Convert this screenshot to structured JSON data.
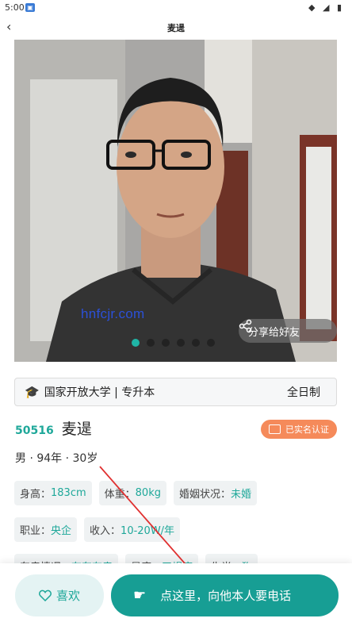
{
  "status_bar": {
    "time": "5:00",
    "app_icon": "app-notification-icon",
    "indicators": "◆ ◢ ▮"
  },
  "nav": {
    "back": "‹",
    "title": "麦遈"
  },
  "photo": {
    "watermark": "hnfcjr.com",
    "share_label": "分享给好友",
    "share_icon": "share-icon",
    "dot_count": 6,
    "active_dot": 0
  },
  "education": {
    "icon": "graduation-cap-icon",
    "school": "国家开放大学 | 专升本",
    "mode": "全日制"
  },
  "profile": {
    "id": "50516",
    "name": "麦遈",
    "verified_label": "已实名认证",
    "basic": "男 · 94年 · 30岁"
  },
  "attributes": [
    [
      {
        "k": "身高：",
        "v": "183cm"
      },
      {
        "k": "体重：",
        "v": "80kg"
      },
      {
        "k": "婚姻状况：",
        "v": "未婚"
      }
    ],
    [
      {
        "k": "职业：",
        "v": "央企"
      },
      {
        "k": "收入：",
        "v": "10-20W/年"
      }
    ],
    [
      {
        "k": "车房情况：",
        "v": "有车有房"
      },
      {
        "k": "星座：",
        "v": "天蝎座"
      },
      {
        "k": "生肖：",
        "v": "狗"
      }
    ]
  ],
  "actions": {
    "like_label": "喜欢",
    "like_icon": "heart-icon",
    "call_label": "点这里，向他本人要电话",
    "call_icon": "pointing-hand-icon"
  },
  "colors": {
    "accent": "#179e94",
    "teal_text": "#1fa89a",
    "verify_badge": "#f58a5a",
    "annotation_arrow": "#e03030"
  }
}
